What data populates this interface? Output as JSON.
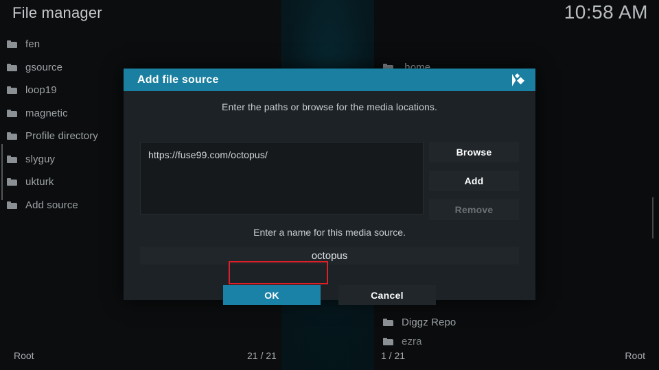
{
  "app": {
    "title": "File manager",
    "clock": "10:58 AM"
  },
  "left_pane": {
    "items": [
      {
        "label": "fen",
        "icon": "folder-icon"
      },
      {
        "label": "gsource",
        "icon": "folder-icon"
      },
      {
        "label": "loop19",
        "icon": "folder-icon"
      },
      {
        "label": "magnetic",
        "icon": "folder-icon"
      },
      {
        "label": "Profile directory",
        "icon": "folder-icon"
      },
      {
        "label": "slyguy",
        "icon": "folder-icon"
      },
      {
        "label": "ukturk",
        "icon": "folder-icon"
      },
      {
        "label": "Add source",
        "icon": "folder-icon"
      }
    ]
  },
  "right_pane": {
    "items": [
      {
        "label": ".home",
        "icon": "folder-icon"
      },
      {
        "label": "Diggz Repo",
        "icon": "folder-icon"
      },
      {
        "label": "ezra",
        "icon": "folder-icon"
      }
    ]
  },
  "status_bar": {
    "left_label": "Root",
    "left_count": "21 / 21",
    "right_count": "1 / 21",
    "right_label": "Root"
  },
  "dialog": {
    "title": "Add file source",
    "logo_icon": "kodi-logo-icon",
    "paths_hint": "Enter the paths or browse for the media locations.",
    "path_value": "https://fuse99.com/octopus/",
    "buttons": {
      "browse": "Browse",
      "add": "Add",
      "remove": "Remove"
    },
    "name_hint": "Enter a name for this media source.",
    "name_value": "octopus",
    "ok": "OK",
    "cancel": "Cancel"
  },
  "colors": {
    "accent_teal": "#1a7fa0",
    "button_teal": "#1a82a6",
    "annotation_red": "#e01f26",
    "dialog_bg": "#1d2226",
    "text_primary": "#e2e6e8",
    "text_muted": "#9ea3a6",
    "text_disabled": "#6b7073"
  }
}
